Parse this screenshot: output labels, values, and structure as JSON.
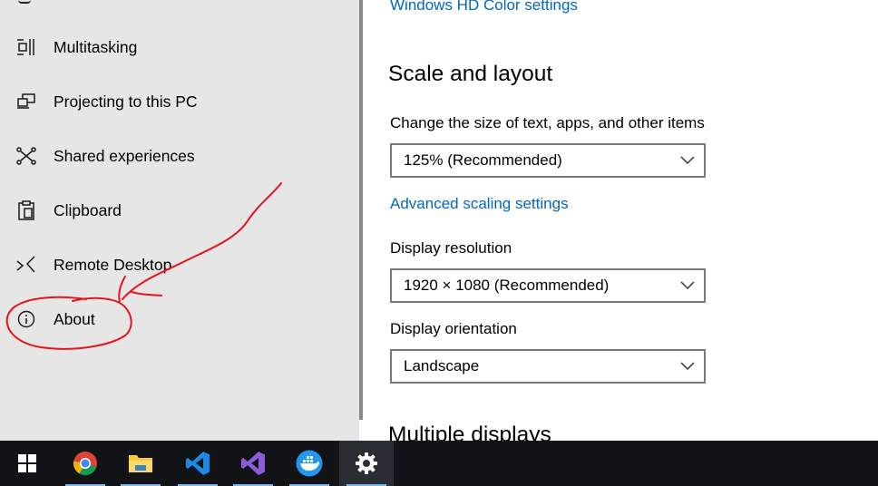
{
  "sidebar": {
    "items": [
      {
        "label": "Multitasking",
        "icon": "multitasking-icon"
      },
      {
        "label": "Projecting to this PC",
        "icon": "projecting-icon"
      },
      {
        "label": "Shared experiences",
        "icon": "shared-experiences-icon"
      },
      {
        "label": "Clipboard",
        "icon": "clipboard-icon"
      },
      {
        "label": "Remote Desktop",
        "icon": "remote-desktop-icon"
      },
      {
        "label": "About",
        "icon": "info-icon"
      }
    ]
  },
  "main": {
    "hd_color_link": "Windows HD Color settings",
    "scale_section_title": "Scale and layout",
    "scale_label": "Change the size of text, apps, and other items",
    "scale_value": "125% (Recommended)",
    "advanced_scaling_link": "Advanced scaling settings",
    "resolution_label": "Display resolution",
    "resolution_value": "1920 × 1080 (Recommended)",
    "orientation_label": "Display orientation",
    "orientation_value": "Landscape",
    "multiple_displays_title": "Multiple displays"
  },
  "taskbar": {
    "items": [
      {
        "icon": "windows-start-icon"
      },
      {
        "icon": "chrome-icon"
      },
      {
        "icon": "file-explorer-icon"
      },
      {
        "icon": "vscode-icon"
      },
      {
        "icon": "visual-studio-icon"
      },
      {
        "icon": "docker-icon"
      },
      {
        "icon": "settings-gear-icon"
      }
    ]
  },
  "colors": {
    "accent_link": "#0067c0",
    "sidebar_bg": "#e6e6e6",
    "taskbar_bg": "#111317",
    "annotation_red": "#e8141c"
  }
}
